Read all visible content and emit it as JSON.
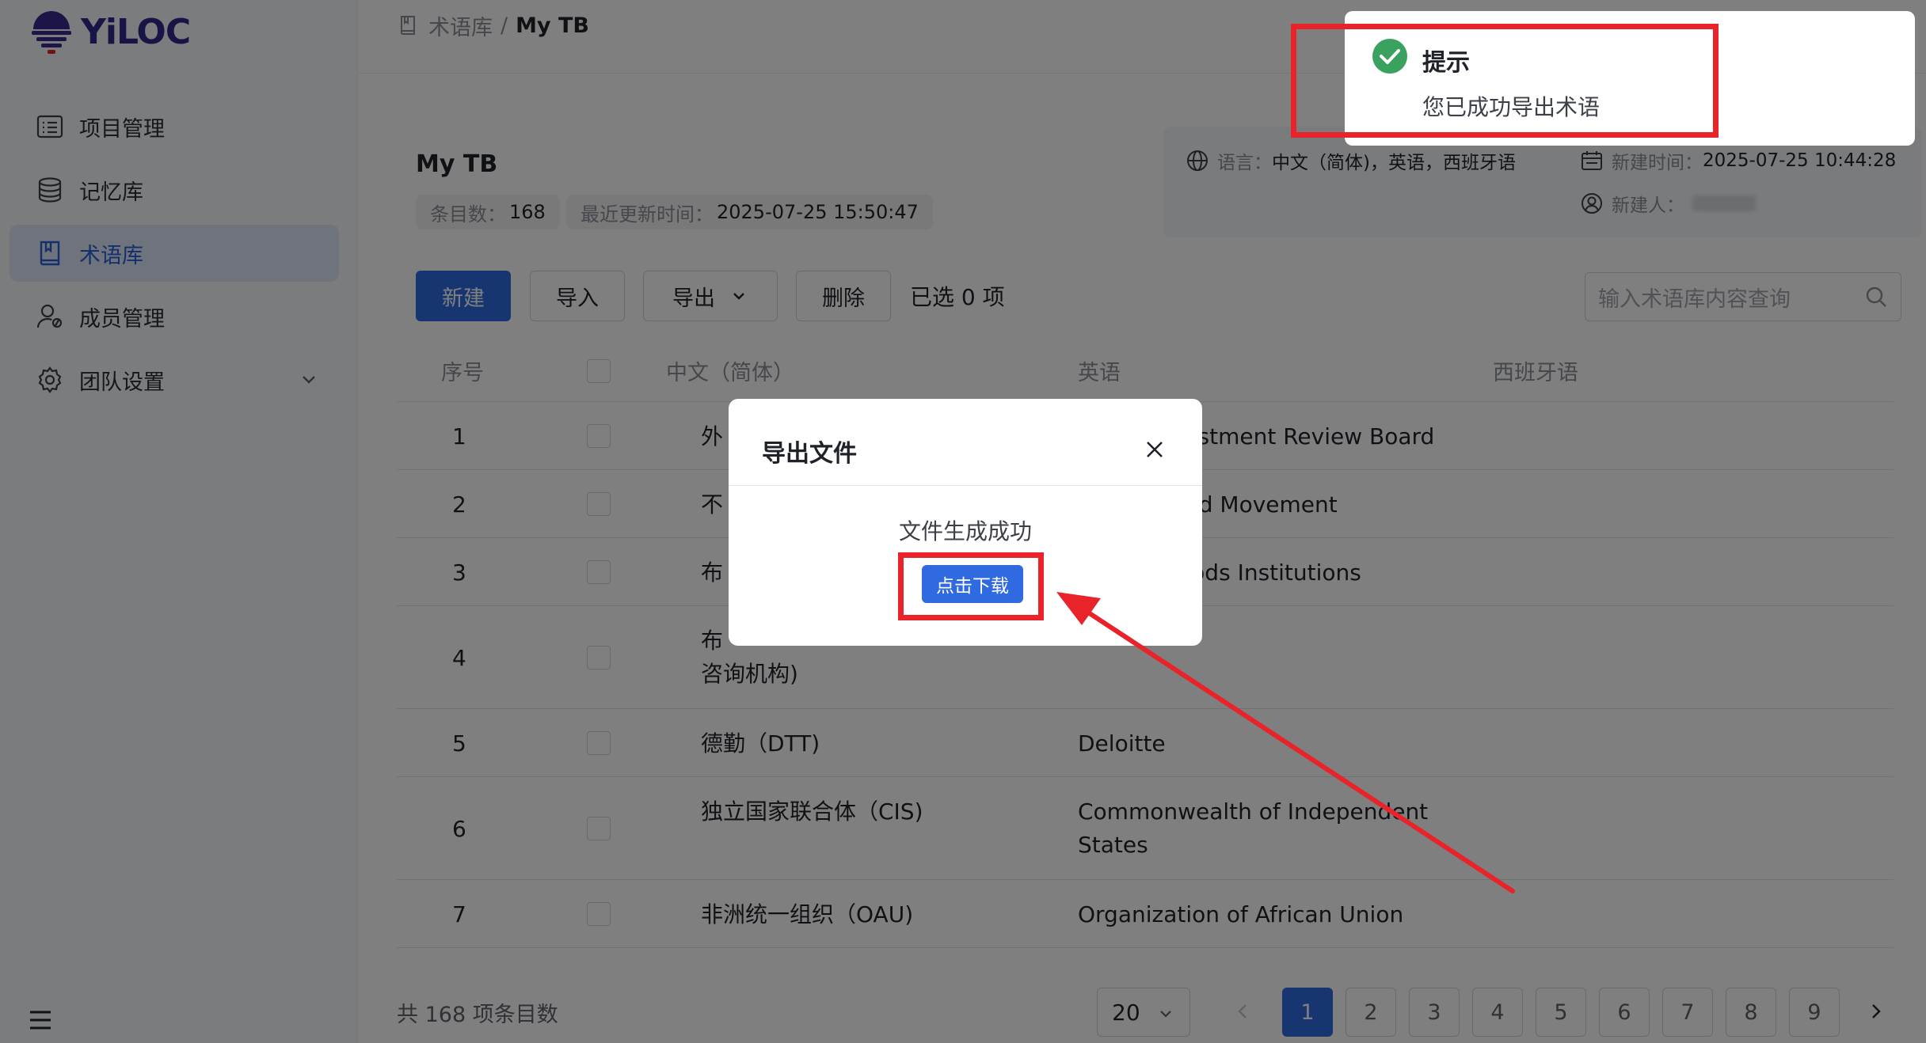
{
  "app": {
    "logo_text": "YiLOC"
  },
  "sidebar": {
    "items": [
      {
        "label": "项目管理",
        "icon": "list-icon"
      },
      {
        "label": "记忆库",
        "icon": "database-icon"
      },
      {
        "label": "术语库",
        "icon": "book-icon",
        "active": true
      },
      {
        "label": "成员管理",
        "icon": "user-group-icon"
      },
      {
        "label": "团队设置",
        "icon": "gear-icon",
        "expandable": true
      }
    ]
  },
  "breadcrumb": {
    "parent": "术语库",
    "separator": "/",
    "current": "My TB"
  },
  "tb": {
    "title": "My TB",
    "count_label": "条目数：",
    "count_value": "168",
    "updated_label": "最近更新时间：",
    "updated_value": "2025-07-25 15:50:47"
  },
  "meta": {
    "lang_label": "语言：",
    "lang_value": "中文（简体)，英语，西班牙语",
    "created_label": "新建时间：",
    "created_value": "2025-07-25 10:44:28",
    "creator_label": "新建人："
  },
  "toolbar": {
    "new": "新建",
    "import": "导入",
    "export": "导出",
    "delete": "删除",
    "selected": "已选 0 项",
    "search_placeholder": "输入术语库内容查询"
  },
  "table": {
    "headers": [
      "序号",
      "中文（简体）",
      "英语",
      "西班牙语"
    ],
    "rows": [
      {
        "no": "1",
        "zh": "外",
        "en": "nvestment Review Board",
        "es": ""
      },
      {
        "no": "2",
        "zh": "不",
        "en": "gned Movement",
        "es": ""
      },
      {
        "no": "3",
        "zh": "布",
        "en": "Woods Institutions",
        "es": ""
      },
      {
        "no": "4",
        "zh": "布",
        "zh2": "咨询机构)",
        "en": "",
        "es": ""
      },
      {
        "no": "5",
        "zh": "德勤（DTT)",
        "en": "Deloitte",
        "es": ""
      },
      {
        "no": "6",
        "zh": "独立国家联合体（CIS)",
        "en": "Commonwealth of Independent",
        "en2": "States",
        "es": ""
      },
      {
        "no": "7",
        "zh": "非洲统一组织（OAU)",
        "en": "Organization of African Union",
        "es": ""
      }
    ]
  },
  "pager": {
    "total": "共 168 项条目数",
    "page_size": "20",
    "pages": [
      "1",
      "2",
      "3",
      "4",
      "5",
      "6",
      "7",
      "8",
      "9"
    ],
    "current": "1"
  },
  "modal": {
    "title": "导出文件",
    "message": "文件生成成功",
    "download": "点击下载"
  },
  "toast": {
    "title": "提示",
    "message": "您已成功导出术语"
  },
  "colors": {
    "primary": "#2f6ae0",
    "success": "#3aa25f",
    "annotation": "#e8232a",
    "logo": "#2f2a8a"
  }
}
